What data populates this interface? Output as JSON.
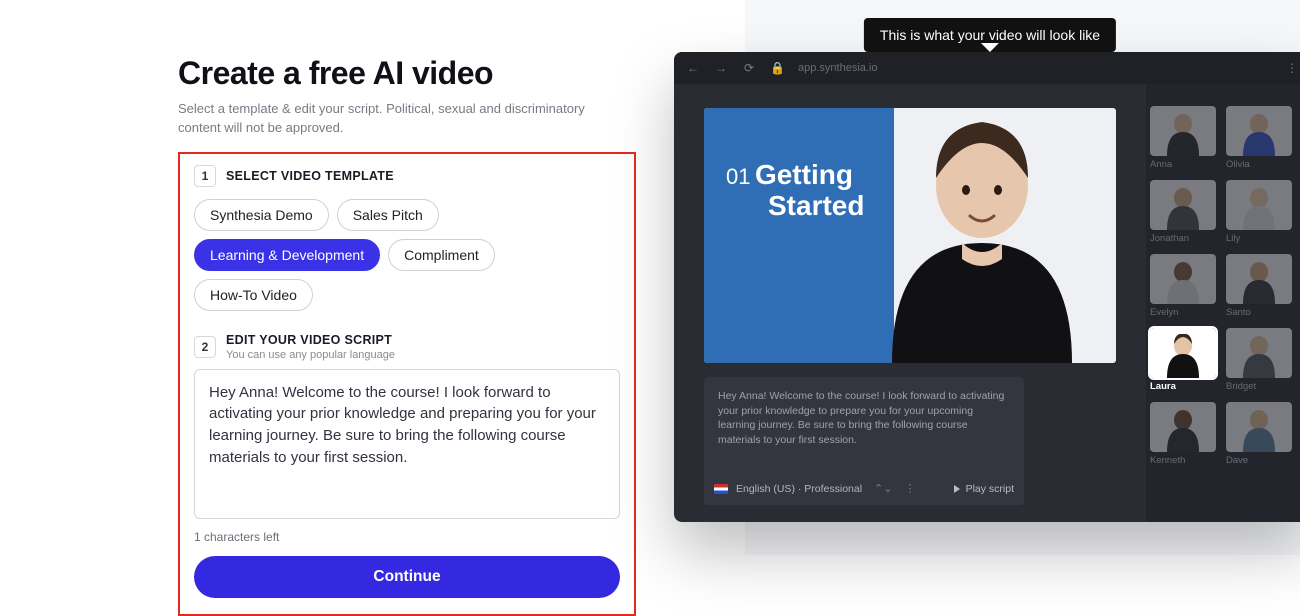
{
  "page": {
    "title": "Create a free AI video",
    "subtitle": "Select a template & edit your script. Political, sexual and discriminatory content will not be approved."
  },
  "step1": {
    "num": "1",
    "label": "SELECT VIDEO TEMPLATE",
    "templates": [
      {
        "label": "Synthesia Demo",
        "active": false
      },
      {
        "label": "Sales Pitch",
        "active": false
      },
      {
        "label": "Learning & Development",
        "active": true
      },
      {
        "label": "Compliment",
        "active": false
      },
      {
        "label": "How-To Video",
        "active": false
      }
    ]
  },
  "step2": {
    "num": "2",
    "label": "EDIT YOUR VIDEO SCRIPT",
    "sub": "You can use any popular language",
    "script": "Hey Anna! Welcome to the course! I look forward to activating your prior knowledge and preparing you for your learning journey. Be sure to bring the following course materials to your first session.",
    "chars_left": "1 characters left"
  },
  "cta": {
    "continue": "Continue"
  },
  "preview": {
    "tooltip": "This is what your video will look like",
    "url": "app.synthesia.io",
    "slide": {
      "num": "01",
      "title_l1": "Getting",
      "title_l2": "Started"
    },
    "script_text": "Hey Anna! Welcome to the course! I look forward to activating your prior knowledge to prepare you for your upcoming learning journey. Be sure to bring the following course materials to your first session.",
    "language": "English (US) · Professional",
    "play_label": "Play script",
    "avatars": [
      {
        "name": "Anna"
      },
      {
        "name": "Olivia"
      },
      {
        "name": "Jonathan"
      },
      {
        "name": "Lily"
      },
      {
        "name": "Evelyn"
      },
      {
        "name": "Santo"
      },
      {
        "name": "Laura",
        "selected": true
      },
      {
        "name": "Bridget"
      },
      {
        "name": "Kenneth"
      },
      {
        "name": "Dave"
      }
    ]
  }
}
